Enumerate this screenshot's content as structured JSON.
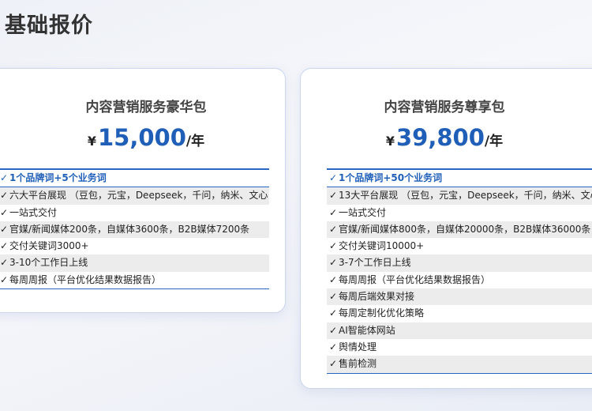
{
  "page": {
    "title": "基础报价"
  },
  "icons": {
    "check": "check-icon"
  },
  "colors": {
    "accent": "#1f5fb8",
    "stripe": "#ececec"
  },
  "packages": [
    {
      "name": "内容营销服务豪华包",
      "currency": "¥",
      "amount": "15,000",
      "unit": "/年",
      "features": [
        "1个品牌词+5个业务词",
        "六大平台展现 （豆包，元宝，Deepseek，千问，纳米、文心 ）",
        "一站式交付",
        "官媒/新闻媒体200条，自媒体3600条，B2B媒体7200条",
        "交付关键词3000+",
        "3-10个工作日上线",
        "每周周报（平台优化结果数据报告）"
      ]
    },
    {
      "name": "内容营销服务尊享包",
      "currency": "¥",
      "amount": "39,800",
      "unit": "/年",
      "features": [
        "1个品牌词+50个业务词",
        "13大平台展现 （豆包，元宝，Deepseek，千问，纳米、文心",
        "一站式交付",
        "官媒/新闻媒体800条，自媒体20000条，B2B媒体36000条",
        "交付关键词10000+",
        "3-7个工作日上线",
        "每周周报（平台优化结果数据报告）",
        "每周后端效果对接",
        "每周定制化优化策略",
        "AI智能体网站",
        "舆情处理",
        "售前检测"
      ]
    }
  ]
}
